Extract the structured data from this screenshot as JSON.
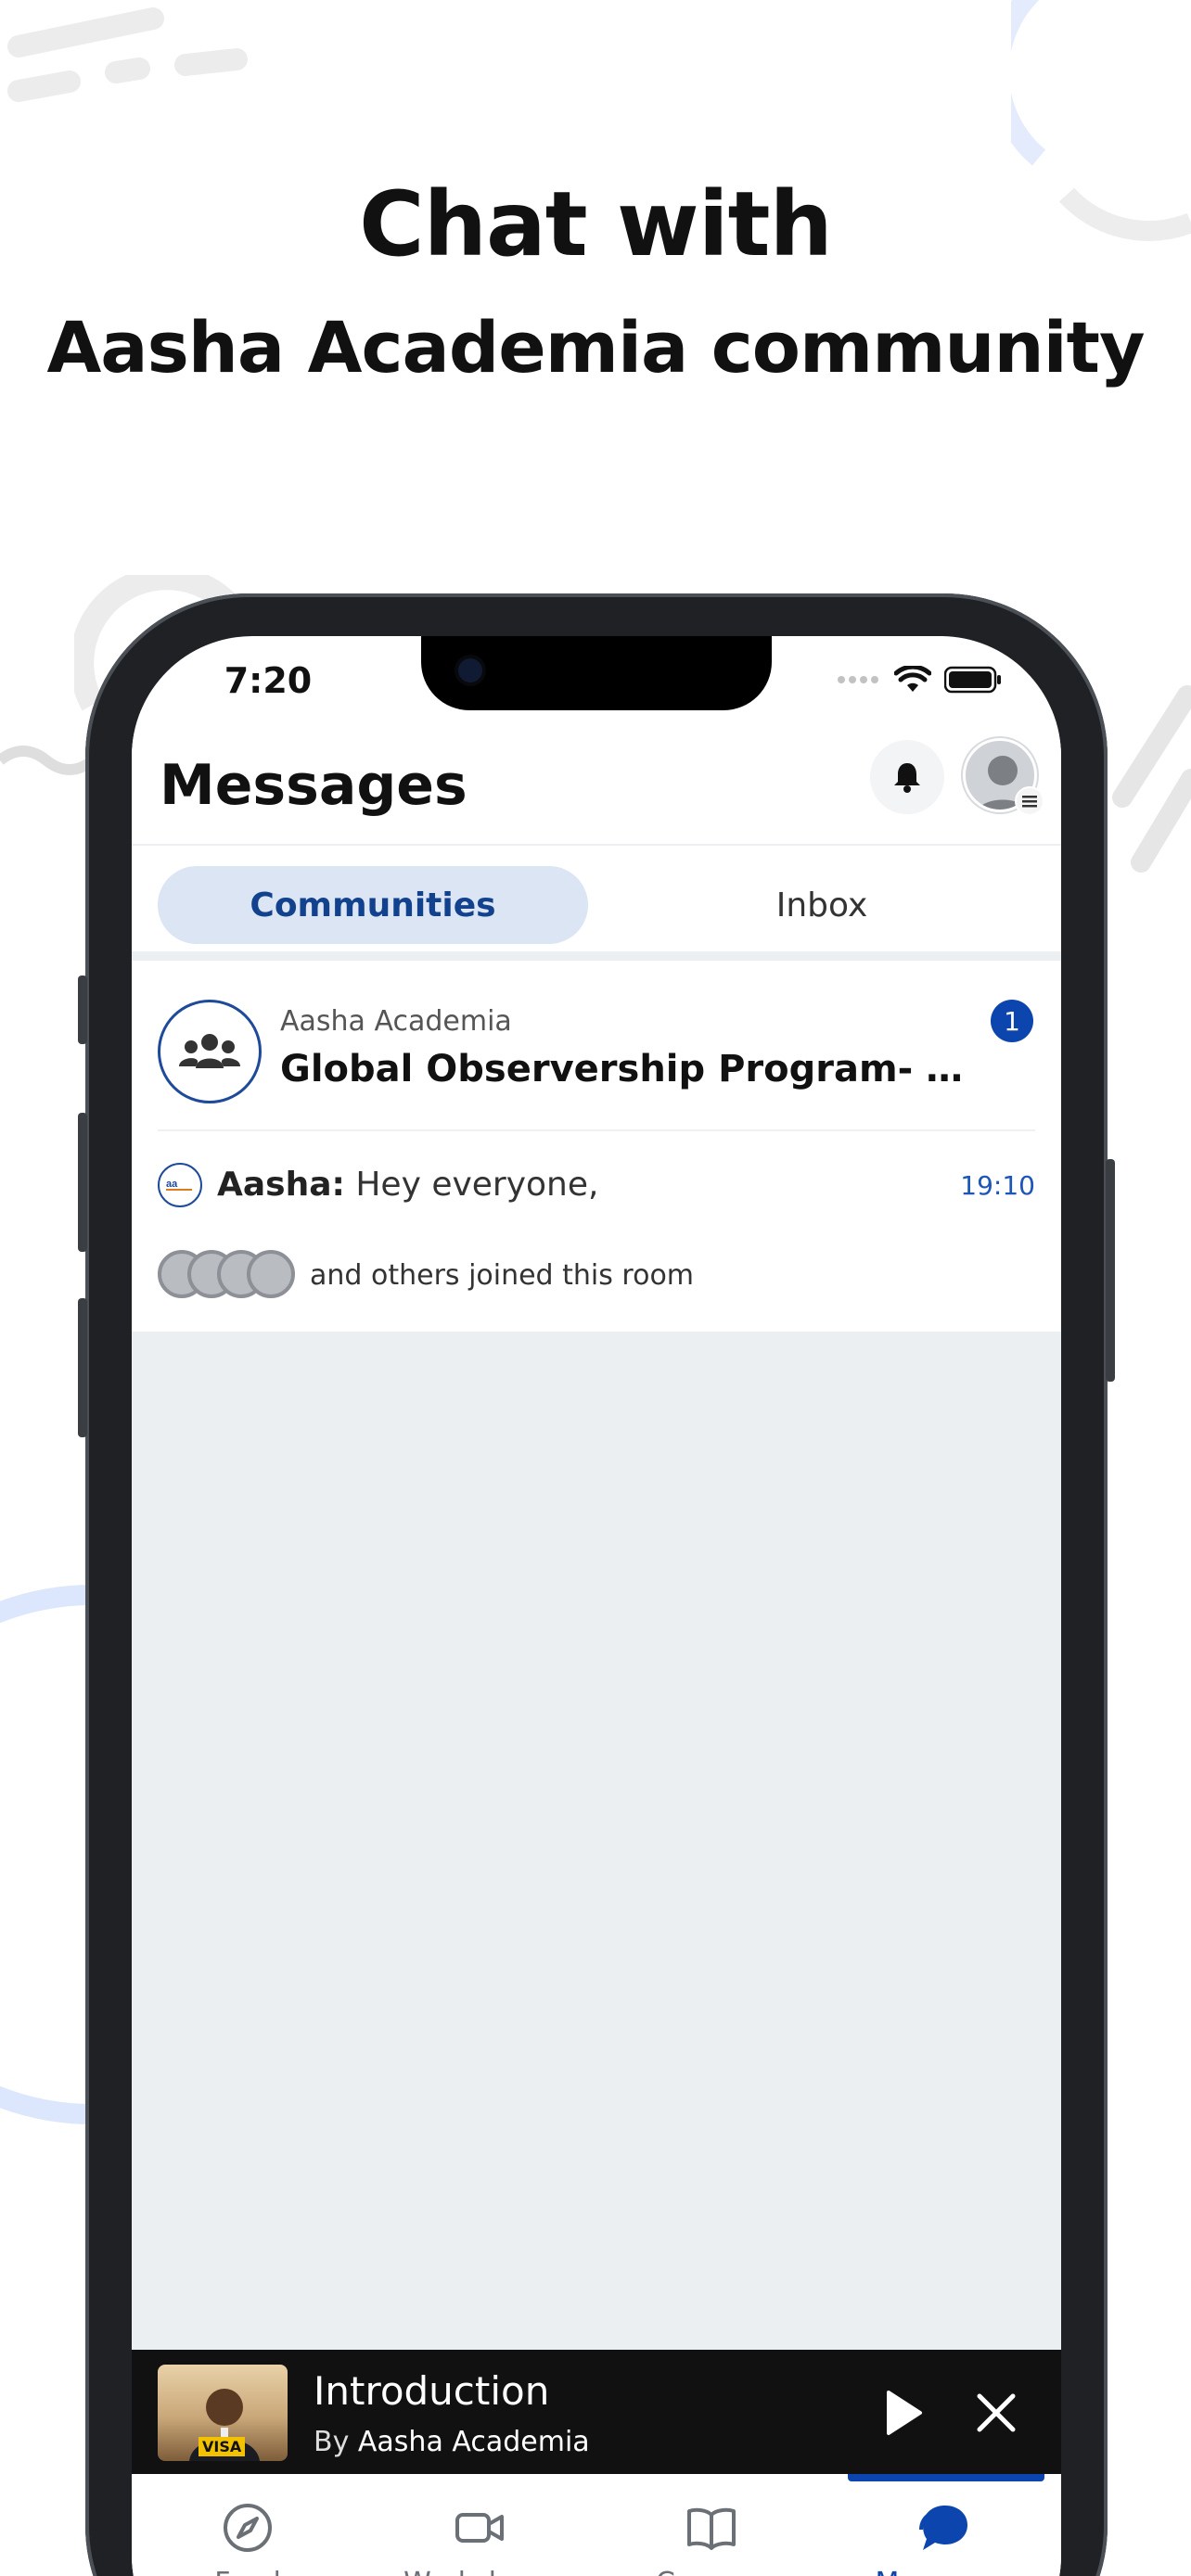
{
  "hero": {
    "title": "Chat with",
    "subtitle": "Aasha Academia community"
  },
  "status_bar": {
    "time": "7:20"
  },
  "header": {
    "title": "Messages"
  },
  "tabs": [
    {
      "label": "Communities",
      "active": true
    },
    {
      "label": "Inbox",
      "active": false
    }
  ],
  "room": {
    "community": "Aasha Academia",
    "title": "Global Observership Program- USA…",
    "unread_count": "1",
    "last_message": {
      "sender": "Aasha:",
      "text": "Hey everyone,",
      "time": "19:10"
    },
    "joined_text": "and others joined this room"
  },
  "player": {
    "title": "Introduction",
    "by_prefix": "By",
    "author": "Aasha Academia",
    "thumb_tag": "VISA"
  },
  "bottom_nav": [
    {
      "label": "Feed",
      "icon": "compass-icon",
      "active": false
    },
    {
      "label": "Workshops",
      "icon": "video-camera-icon",
      "active": false
    },
    {
      "label": "Courses",
      "icon": "book-icon",
      "active": false
    },
    {
      "label": "Messages",
      "icon": "chat-bubble-icon",
      "active": true
    }
  ],
  "colors": {
    "accent": "#0b45ad",
    "tab_active_bg": "#dbe5f3",
    "list_bg": "#eceff2",
    "player_bg": "#111111"
  }
}
